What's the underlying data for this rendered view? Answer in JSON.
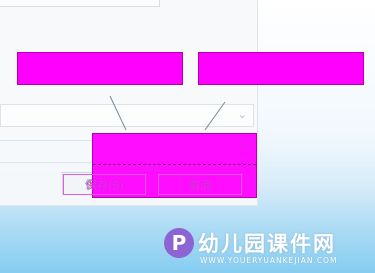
{
  "dialog": {
    "save_label": "保存(S)",
    "cancel_label": "取消"
  },
  "watermark": {
    "logo_letter": "P",
    "title": "幼儿园课件网",
    "url": "WWW.YOUERYUANKEJIAN.COM"
  },
  "colors": {
    "highlight": "#ff00ff",
    "background_bottom": "#86cdf1"
  }
}
